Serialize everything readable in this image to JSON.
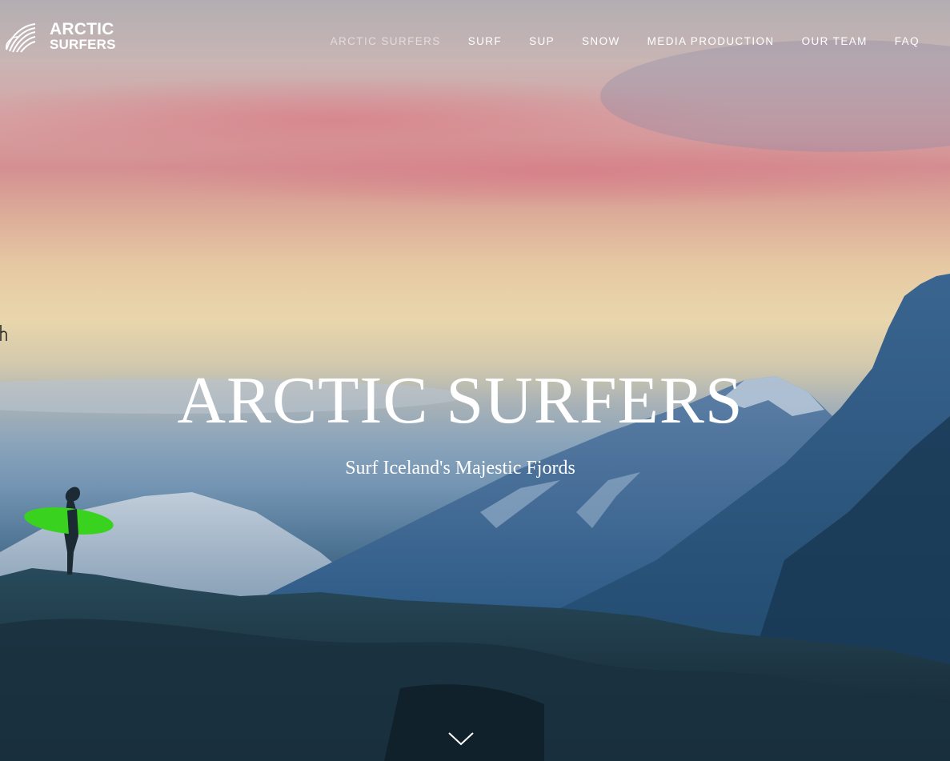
{
  "brand": {
    "line1": "ARCTIC",
    "line2": "SURFERS",
    "logo_icon": "wave-swirl-icon"
  },
  "nav": {
    "items": [
      {
        "label": "ARCTIC SURFERS",
        "active": true
      },
      {
        "label": "SURF",
        "active": false
      },
      {
        "label": "SUP",
        "active": false
      },
      {
        "label": "SNOW",
        "active": false
      },
      {
        "label": "MEDIA PRODUCTION",
        "active": false
      },
      {
        "label": "OUR TEAM",
        "active": false
      },
      {
        "label": "FAQ",
        "active": false
      }
    ]
  },
  "hero": {
    "title": "ARCTIC SURFERS",
    "subtitle": "Surf Iceland's Majestic Fjords",
    "scroll_icon": "chevron-down-icon"
  },
  "colors": {
    "text": "#ffffff",
    "nav_active": "#c9c3c6",
    "surfboard": "#39d31f"
  }
}
